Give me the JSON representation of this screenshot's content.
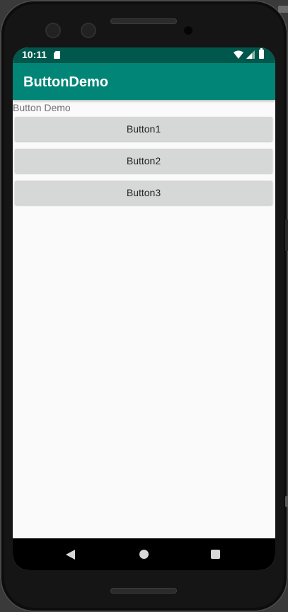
{
  "status_bar": {
    "time": "10:11"
  },
  "app_bar": {
    "title": "ButtonDemo"
  },
  "main": {
    "label": "Button Demo",
    "buttons": [
      {
        "label": "Button1"
      },
      {
        "label": "Button2"
      },
      {
        "label": "Button3"
      }
    ]
  },
  "colors": {
    "status_bar": "#00574b",
    "app_bar": "#008577",
    "button": "#d6d7d7",
    "background": "#fafafa"
  },
  "icons": [
    "sd-card-icon",
    "wifi-icon",
    "signal-icon",
    "battery-icon",
    "back-icon",
    "home-icon",
    "recents-icon"
  ]
}
